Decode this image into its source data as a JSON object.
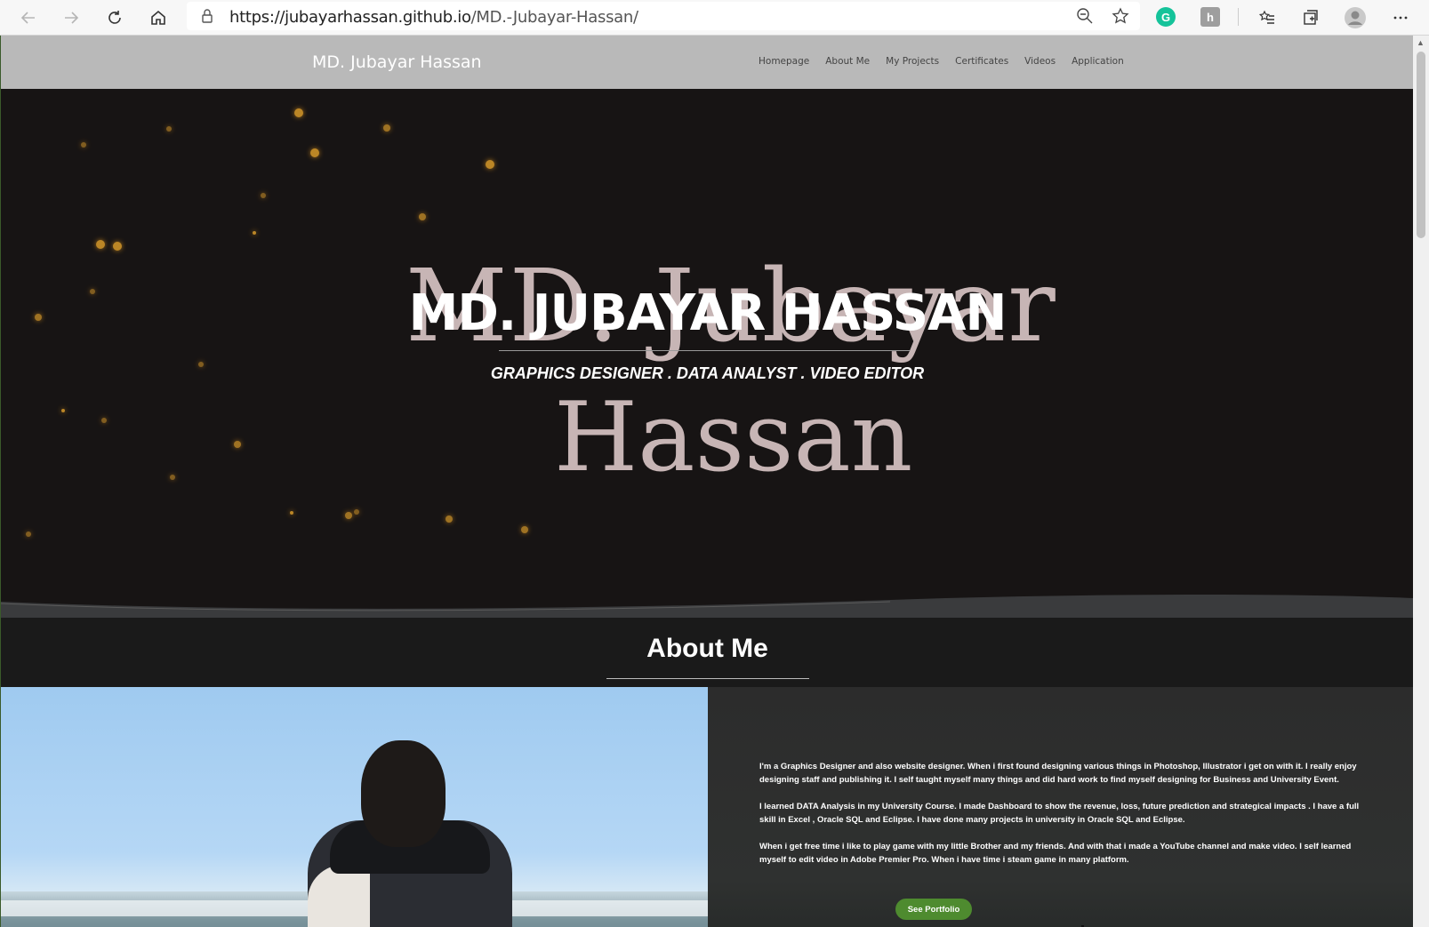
{
  "browser": {
    "url_host": "https://jubayarhassan.github.io",
    "url_path": "/MD.-Jubayar-Hassan/",
    "icons": [
      "back-icon",
      "forward-icon",
      "refresh-icon",
      "home-icon",
      "lock-icon",
      "zoom-icon",
      "favorite-star-icon",
      "grammarly-icon",
      "extension-icon",
      "favorites-list-icon",
      "collections-icon",
      "profile-avatar-icon",
      "more-options-icon"
    ]
  },
  "nav": {
    "brand": "MD. Jubayar Hassan",
    "links": [
      "Homepage",
      "About Me",
      "My Projects",
      "Certificates",
      "Videos",
      "Application"
    ]
  },
  "hero": {
    "bg_line1": "MD. Jubayar",
    "bg_line2": "Hassan",
    "title": "MD. JUBAYAR HASSAN",
    "subtitle": "GRAPHICS DESIGNER . DATA ANALYST . VIDEO EDITOR"
  },
  "about": {
    "title": "About Me",
    "paragraphs": [
      "I'm a Graphics Designer and also website designer. When i first found designing various things in Photoshop, Illustrator i get on with it. I really enjoy designing staff and publishing it. I self taught myself many things and did hard work to find myself designing for Business and University Event.",
      "I learned DATA Analysis in my University Course. I made Dashboard to show the revenue, loss, future prediction and strategical impacts . I have a full skill in Excel , Oracle SQL and Eclipse. I have done many projects in university in Oracle SQL and Eclipse.",
      "When i get free time i like to play game with my little Brother and my friends. And with that i made a YouTube channel and make video. I self learned myself to edit video in Adobe Premier Pro. When i have time i steam game in many platform."
    ],
    "button": "See Portfolio"
  },
  "colors": {
    "navbar": "#b9b9b9",
    "hero_bg": "#171414",
    "button": "#4e8b2f",
    "grammarly": "#15c39a"
  }
}
